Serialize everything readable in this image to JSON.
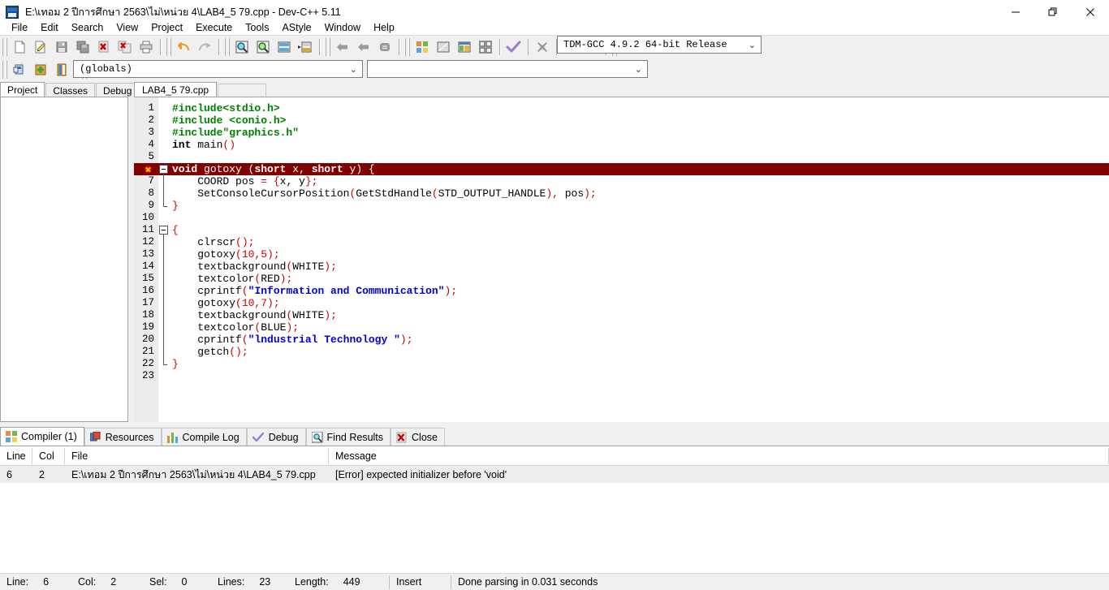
{
  "window": {
    "title": "E:\\เทอม 2 ปีการศึกษา 2563\\ไม่\\หน่วย 4\\LAB4_5 79.cpp - Dev-C++ 5.11",
    "app_icon": "dev-cpp-icon",
    "minimize": "—",
    "maximize": "❐",
    "close": "✕",
    "accent_color": "#0078d7"
  },
  "menu": {
    "items": [
      {
        "label": "File"
      },
      {
        "label": "Edit"
      },
      {
        "label": "Search"
      },
      {
        "label": "View"
      },
      {
        "label": "Project"
      },
      {
        "label": "Execute"
      },
      {
        "label": "Tools"
      },
      {
        "label": "AStyle"
      },
      {
        "label": "Window"
      },
      {
        "label": "Help"
      }
    ]
  },
  "toolbar": {
    "compiler_combo": {
      "value": "TDM-GCC 4.9.2 64-bit Release",
      "arrow": "⌄"
    },
    "groups": [
      {
        "buttons": [
          "new-file-icon",
          "open-file-icon",
          "save-icon",
          "save-all-icon",
          "close-file-icon",
          "close-all-icon",
          "print-icon"
        ]
      },
      {
        "buttons": [
          "undo-icon",
          "redo-icon"
        ]
      },
      {
        "buttons": [
          "find-icon",
          "replace-icon",
          "goto-line-icon",
          "goto-function-icon"
        ]
      },
      {
        "buttons": [
          "back-icon",
          "forward-icon",
          "toggle-bookmark-icon"
        ]
      },
      {
        "buttons": [
          "compile-icon",
          "run-icon",
          "compile-and-run-icon",
          "rebuild-all-icon",
          "debug-icon"
        ]
      },
      {
        "buttons": [
          "stop-execution-icon"
        ]
      },
      {
        "buttons": [
          "profile-icon",
          "delete-profile-icon"
        ]
      }
    ]
  },
  "toolbar2": {
    "buttons": [
      "new-class-icon",
      "add-member-icon",
      "project-view-icon"
    ],
    "globals_combo": {
      "value": "(globals)",
      "arrow": "⌄"
    },
    "class_combo": {
      "value": "",
      "arrow": "⌄"
    }
  },
  "left_panel": {
    "tabs": [
      {
        "label": "Project",
        "active": true
      },
      {
        "label": "Classes",
        "active": false
      },
      {
        "label": "Debug",
        "active": false
      }
    ]
  },
  "editor": {
    "tabs": [
      {
        "label": "LAB4_5 79.cpp",
        "active": true
      }
    ],
    "error_line": 6,
    "error_bg": "#800000",
    "lines": [
      {
        "n": 1,
        "tokens": [
          {
            "t": "#include",
            "c": "pp"
          },
          {
            "t": "<stdio.h>",
            "c": "pp"
          }
        ]
      },
      {
        "n": 2,
        "tokens": [
          {
            "t": "#include <conio.h>",
            "c": "pp"
          }
        ]
      },
      {
        "n": 3,
        "tokens": [
          {
            "t": "#include\"graphics.h\"",
            "c": "pp"
          }
        ]
      },
      {
        "n": 4,
        "tokens": [
          {
            "t": "int",
            "c": "k"
          },
          {
            "t": " main",
            "c": "id"
          },
          {
            "t": "()",
            "c": "sy"
          }
        ]
      },
      {
        "n": 5,
        "tokens": []
      },
      {
        "n": 6,
        "error": true,
        "fold": "start",
        "tokens": [
          {
            "t": "void",
            "c": "whtb"
          },
          {
            "t": " gotoxy ",
            "c": "wht"
          },
          {
            "t": "(",
            "c": "wht"
          },
          {
            "t": "short",
            "c": "whtb"
          },
          {
            "t": " x",
            "c": "wht"
          },
          {
            "t": ", ",
            "c": "wht"
          },
          {
            "t": "short",
            "c": "whtb"
          },
          {
            "t": " y",
            "c": "wht"
          },
          {
            "t": ") {",
            "c": "wht"
          }
        ]
      },
      {
        "n": 7,
        "tokens": [
          {
            "t": "    COORD pos ",
            "c": "id"
          },
          {
            "t": "=",
            "c": "sy"
          },
          {
            "t": " ",
            "c": "id"
          },
          {
            "t": "{",
            "c": "sy"
          },
          {
            "t": "x, y",
            "c": "id"
          },
          {
            "t": "};",
            "c": "sy"
          }
        ]
      },
      {
        "n": 8,
        "tokens": [
          {
            "t": "    SetConsoleCursorPosition",
            "c": "id"
          },
          {
            "t": "(",
            "c": "sy"
          },
          {
            "t": "GetStdHandle",
            "c": "id"
          },
          {
            "t": "(",
            "c": "sy"
          },
          {
            "t": "STD_OUTPUT_HANDLE",
            "c": "id"
          },
          {
            "t": "), ",
            "c": "sy"
          },
          {
            "t": "pos",
            "c": "id"
          },
          {
            "t": ");",
            "c": "sy"
          }
        ]
      },
      {
        "n": 9,
        "fold": "end",
        "tokens": [
          {
            "t": "}",
            "c": "sy"
          }
        ]
      },
      {
        "n": 10,
        "tokens": []
      },
      {
        "n": 11,
        "fold": "start",
        "tokens": [
          {
            "t": "{",
            "c": "sy"
          }
        ]
      },
      {
        "n": 12,
        "tokens": [
          {
            "t": "    clrscr",
            "c": "id"
          },
          {
            "t": "();",
            "c": "sy"
          }
        ]
      },
      {
        "n": 13,
        "tokens": [
          {
            "t": "    gotoxy",
            "c": "id"
          },
          {
            "t": "(10,5);",
            "c": "sy"
          }
        ]
      },
      {
        "n": 14,
        "tokens": [
          {
            "t": "    textbackground",
            "c": "id"
          },
          {
            "t": "(",
            "c": "sy"
          },
          {
            "t": "WHITE",
            "c": "id"
          },
          {
            "t": ");",
            "c": "sy"
          }
        ]
      },
      {
        "n": 15,
        "tokens": [
          {
            "t": "    textcolor",
            "c": "id"
          },
          {
            "t": "(",
            "c": "sy"
          },
          {
            "t": "RED",
            "c": "id"
          },
          {
            "t": ");",
            "c": "sy"
          }
        ]
      },
      {
        "n": 16,
        "tokens": [
          {
            "t": "    cprintf",
            "c": "id"
          },
          {
            "t": "(",
            "c": "sy"
          },
          {
            "t": "\"Information and Communication\"",
            "c": "st"
          },
          {
            "t": ");",
            "c": "sy"
          }
        ]
      },
      {
        "n": 17,
        "tokens": [
          {
            "t": "    gotoxy",
            "c": "id"
          },
          {
            "t": "(10,7);",
            "c": "sy"
          }
        ]
      },
      {
        "n": 18,
        "tokens": [
          {
            "t": "    textbackground",
            "c": "id"
          },
          {
            "t": "(",
            "c": "sy"
          },
          {
            "t": "WHITE",
            "c": "id"
          },
          {
            "t": ");",
            "c": "sy"
          }
        ]
      },
      {
        "n": 19,
        "tokens": [
          {
            "t": "    textcolor",
            "c": "id"
          },
          {
            "t": "(",
            "c": "sy"
          },
          {
            "t": "BLUE",
            "c": "id"
          },
          {
            "t": ");",
            "c": "sy"
          }
        ]
      },
      {
        "n": 20,
        "tokens": [
          {
            "t": "    cprintf",
            "c": "id"
          },
          {
            "t": "(",
            "c": "sy"
          },
          {
            "t": "\"lndustrial Technology \"",
            "c": "st"
          },
          {
            "t": ");",
            "c": "sy"
          }
        ]
      },
      {
        "n": 21,
        "tokens": [
          {
            "t": "    getch",
            "c": "id"
          },
          {
            "t": "();",
            "c": "sy"
          }
        ]
      },
      {
        "n": 22,
        "fold": "end",
        "tokens": [
          {
            "t": "}",
            "c": "sy"
          }
        ]
      },
      {
        "n": 23,
        "tokens": []
      }
    ]
  },
  "bottom_panel": {
    "tabs": [
      {
        "label": "Compiler (1)",
        "icon": "compiler-icon",
        "active": true
      },
      {
        "label": "Resources",
        "icon": "resources-icon",
        "active": false
      },
      {
        "label": "Compile Log",
        "icon": "compile-log-icon",
        "active": false
      },
      {
        "label": "Debug",
        "icon": "debug-check-icon",
        "active": false
      },
      {
        "label": "Find Results",
        "icon": "find-results-icon",
        "active": false
      },
      {
        "label": "Close",
        "icon": "close-panel-icon",
        "active": false
      }
    ],
    "columns": [
      "Line",
      "Col",
      "File",
      "Message"
    ],
    "rows": [
      {
        "line": "6",
        "col": "2",
        "file": "E:\\เทอม 2 ปีการศึกษา 2563\\ไม่\\หน่วย 4\\LAB4_5 79.cpp",
        "message": "[Error] expected initializer before 'void'"
      }
    ]
  },
  "statusbar": {
    "line_label": "Line:",
    "line_value": "6",
    "col_label": "Col:",
    "col_value": "2",
    "sel_label": "Sel:",
    "sel_value": "0",
    "lines_label": "Lines:",
    "lines_value": "23",
    "length_label": "Length:",
    "length_value": "449",
    "mode": "Insert",
    "message": "Done parsing in 0.031 seconds"
  }
}
